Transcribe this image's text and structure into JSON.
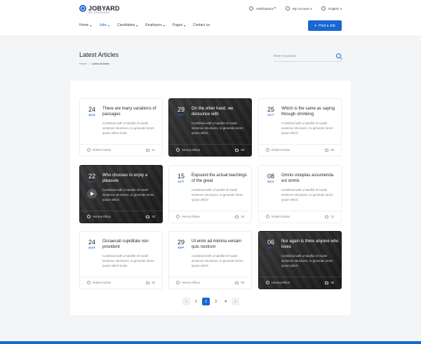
{
  "header": {
    "logo_text": "JOBYARD",
    "logo_sub": "WP JOB BOARD",
    "notifications": "Notifications",
    "my_account": "My Account",
    "language": "English",
    "nav": [
      {
        "label": "Home"
      },
      {
        "label": "Jobs"
      },
      {
        "label": "Candidates"
      },
      {
        "label": "Employers"
      },
      {
        "label": "Pages"
      },
      {
        "label": "Contact us"
      }
    ],
    "post_job": "Post a Job"
  },
  "page": {
    "title": "Latest Articles",
    "breadcrumb_home": "Home",
    "breadcrumb_sep": "/",
    "breadcrumb_current": "Latest Articles",
    "search_placeholder": "Enter Keywords"
  },
  "articles": [
    {
      "day": "24",
      "month": "AUG",
      "title": "There are many variations of passages",
      "excerpt": "Combined with a handful of model sentence structures, to generate lorem Ipsum which looks",
      "author": "Robert Karlos",
      "comments": "42"
    },
    {
      "day": "29",
      "month": "SEP",
      "title": "On the other hand, we denounce with",
      "excerpt": "Combined with a handful of model sentence structures, to generate lorem Ipsum which",
      "author": "Henrey Rikus",
      "comments": "99"
    },
    {
      "day": "25",
      "month": "OCT",
      "title": "Which is the same as saying through shrinking",
      "excerpt": "Combined with a handful of model sentence structures, to generate lorem Ipsum which",
      "author": "Robert Karlos",
      "comments": "66"
    },
    {
      "day": "22",
      "month": "OCT",
      "title": "Who chooses to enjoy a pleasure",
      "excerpt": "Combined with a handful of model sentence structures, to generate lorem Ipsum which",
      "author": "Henrey Rikus",
      "comments": "20"
    },
    {
      "day": "15",
      "month": "OCT",
      "title": "Expound the actual teachings of the great",
      "excerpt": "Combined with a handful of model sentence structures, to generate lorem Ipsum which",
      "author": "Henrey Rikus",
      "comments": "19"
    },
    {
      "day": "08",
      "month": "NOV",
      "title": "Omnis voluptas assumenda est omnis",
      "excerpt": "Combined with a handful of model sentence structures, to generate lorem Ipsum which",
      "author": "Robert Karlos",
      "comments": "13"
    },
    {
      "day": "24",
      "month": "AUG",
      "title": "Occaecati cupiditate non provident",
      "excerpt": "Combined with a handful of model sentence structures, to generate lorem Ipsum which looks",
      "author": "Robert Karlos",
      "comments": "32"
    },
    {
      "day": "29",
      "month": "SEP",
      "title": "Ut enim ad minima veniam quis nostrum",
      "excerpt": "Combined with a handful of model sentence structures, to generate lorem Ipsum which",
      "author": "Henrey Rikus",
      "comments": "99"
    },
    {
      "day": "06",
      "month": "DEC",
      "title": "Nor again is there anyone who loves",
      "excerpt": "Combined with a handful of model sentence structures, to generate lorem Ipsum which",
      "author": "Henrey Rikus",
      "comments": "98"
    }
  ],
  "pagination": {
    "prev": "‹",
    "pages": [
      "1",
      "2",
      "3",
      "4"
    ],
    "current": "2",
    "next": "›"
  },
  "colors": {
    "accent": "#1967d2",
    "text": "#1e2330",
    "muted": "#7a7f8c",
    "background": "#f4f5f7"
  }
}
